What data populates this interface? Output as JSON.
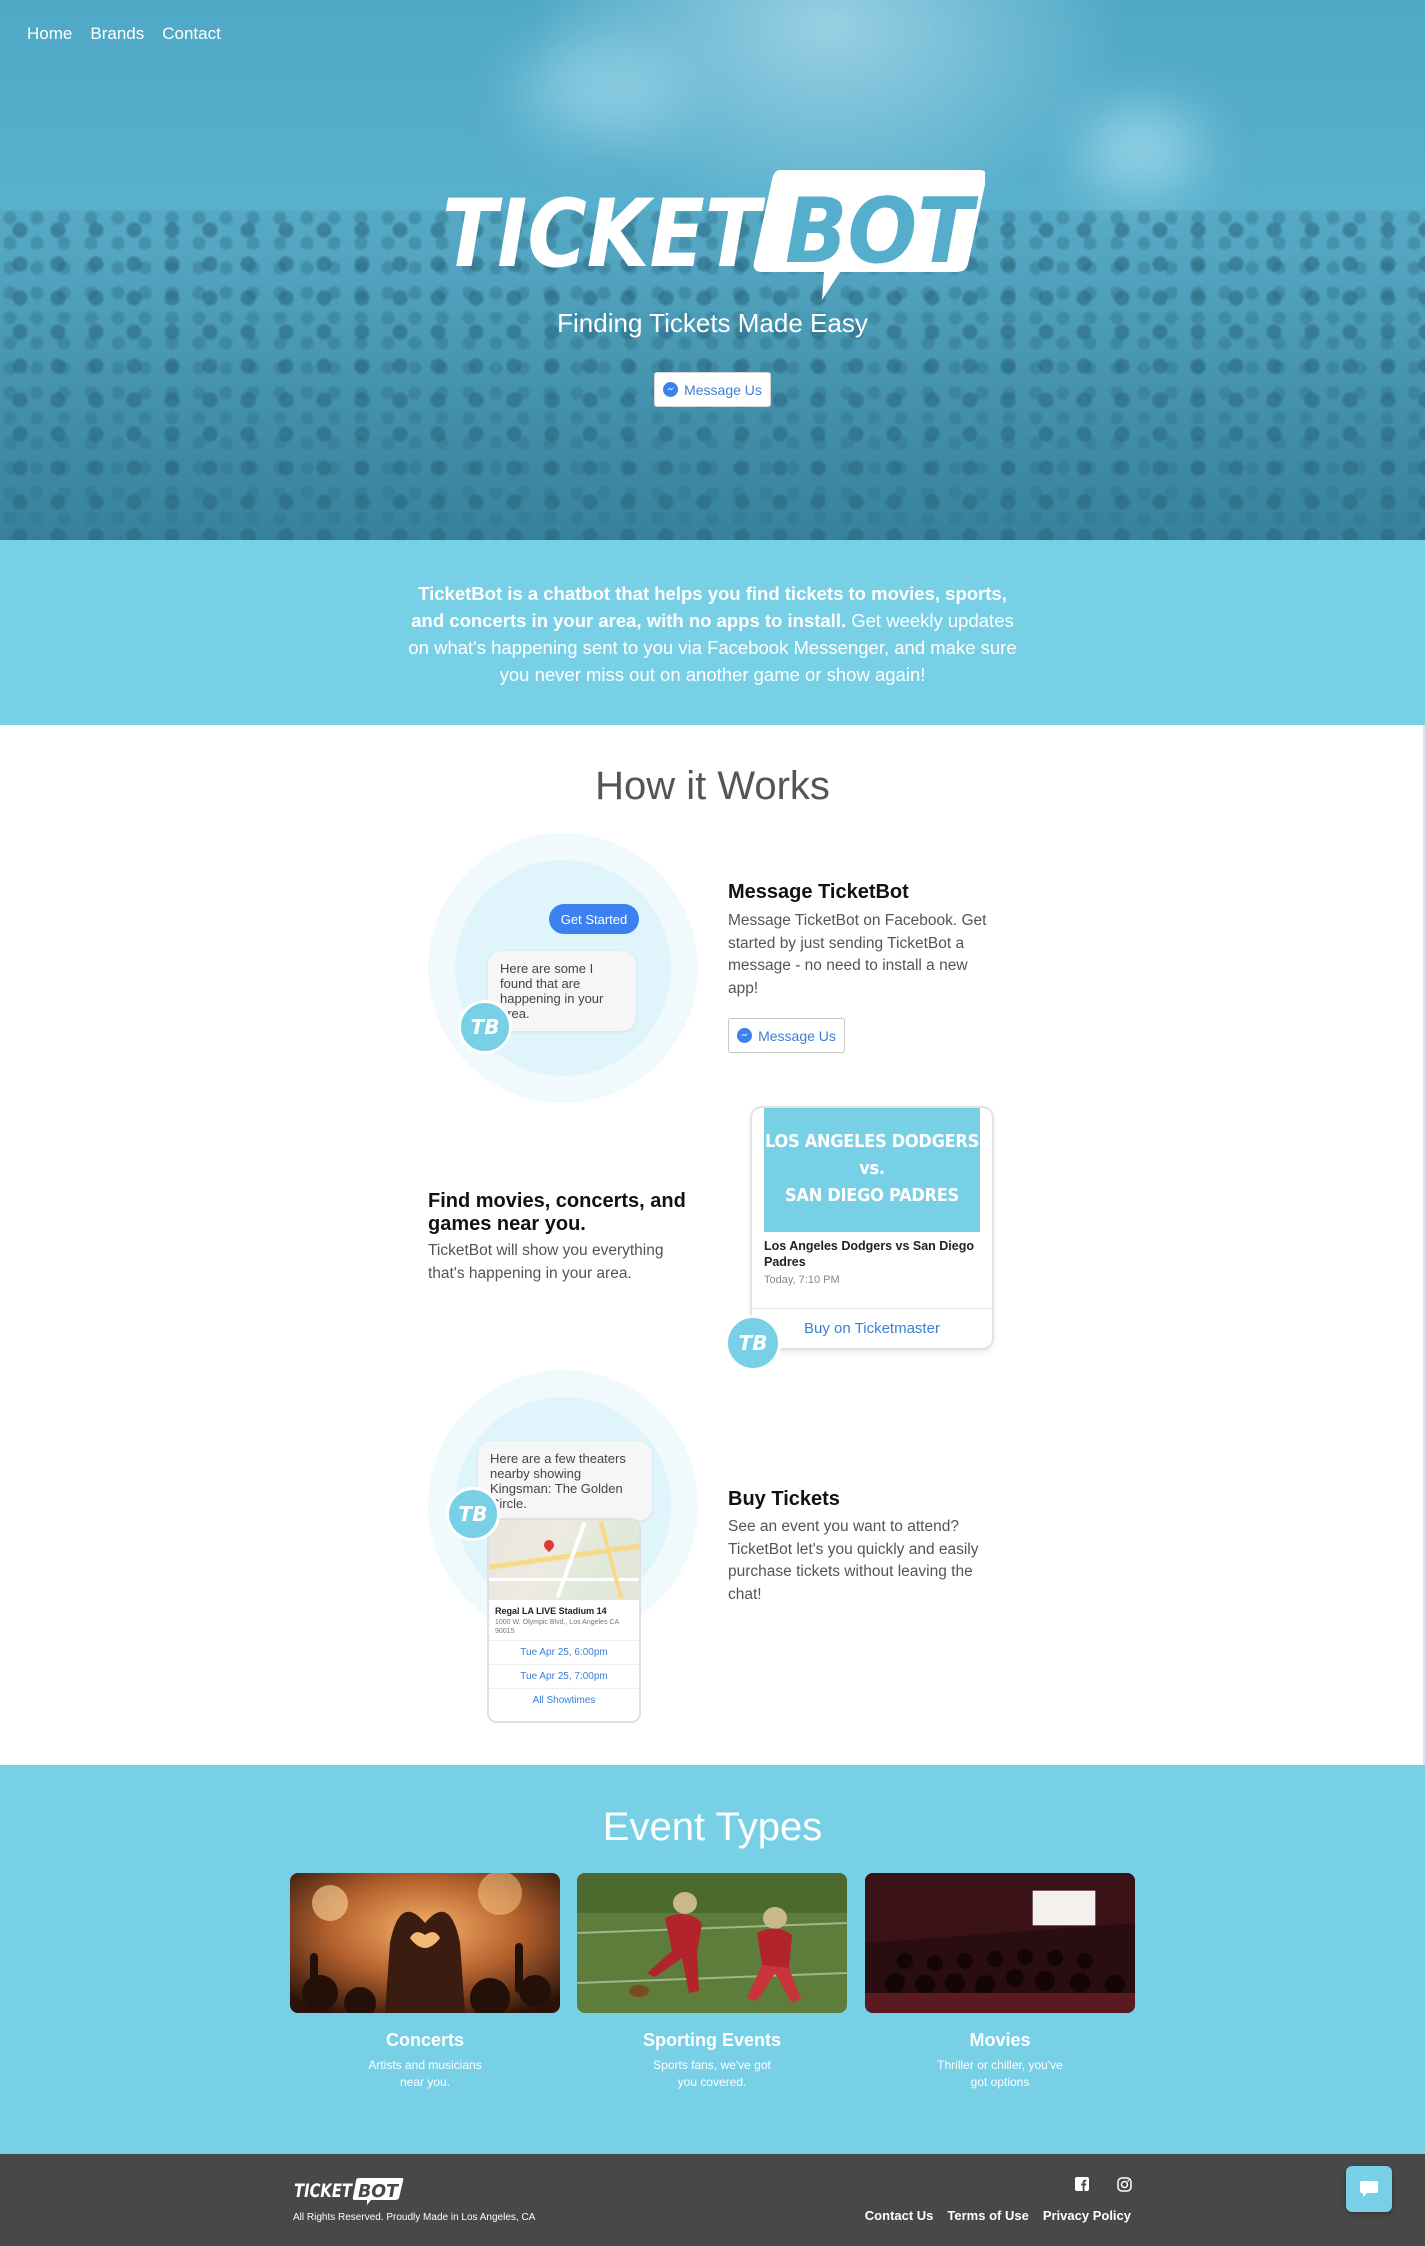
{
  "nav": {
    "items": [
      "Home",
      "Brands",
      "Contact"
    ]
  },
  "hero": {
    "logo_left": "TICKET",
    "logo_right": "BOT",
    "tagline": "Finding Tickets Made Easy",
    "cta_label": "Message Us"
  },
  "intro": {
    "bold": "TicketBot is a chatbot that helps you find tickets to movies, sports, and concerts in your area, with no apps to install.",
    "rest": " Get weekly updates on what's happening sent to you via Facebook Messenger, and make sure you never miss out on another game or show again!"
  },
  "how_it_works": {
    "title": "How it Works",
    "step1": {
      "title": "Message TicketBot",
      "text": "Message TicketBot on Facebook. Get started by just sending TicketBot a message - no need to install a new app!",
      "button": "Message Us",
      "pill": "Get Started",
      "bubble": "Here are some I found that are happening in your area.",
      "badge": "TB"
    },
    "step2": {
      "title": "Find movies, concerts, and games near you.",
      "text": "TicketBot will show you everything that's happening in your area.",
      "card_line1": "LOS ANGELES DODGERS",
      "card_line2": "vs.",
      "card_line3": "SAN DIEGO PADRES",
      "card_title": "Los Angeles Dodgers vs San Diego Padres",
      "card_time": "Today, 7:10 PM",
      "card_buy": "Buy on Ticketmaster",
      "badge": "TB"
    },
    "step3": {
      "title": "Buy Tickets",
      "text": "See an event you want to attend? TicketBot let's you quickly and easily purchase tickets without leaving the chat!",
      "bubble": "Here are a few theaters nearby showing Kingsman: The Golden Circle.",
      "theater_name": "Regal LA LIVE Stadium 14",
      "theater_addr": "1000 W. Olympic Blvd., Los Angeles CA 90015",
      "showtimes": [
        "Tue Apr 25, 6:00pm",
        "Tue Apr 25, 7:00pm",
        "All Showtimes"
      ],
      "badge": "TB"
    }
  },
  "events": {
    "title": "Event Types",
    "items": [
      {
        "name": "Concerts",
        "desc": "Artists and musicians near you."
      },
      {
        "name": "Sporting Events",
        "desc": "Sports fans, we've got you covered."
      },
      {
        "name": "Movies",
        "desc": "Thriller or chiller, you've got options"
      }
    ]
  },
  "footer": {
    "logo_left": "TICKET",
    "logo_right": "BOT",
    "copyright": "All Rights Reserved. Proudly Made in Los Angeles, CA",
    "links": [
      "Contact Us",
      "Terms of Use",
      "Privacy Policy"
    ],
    "social": [
      "facebook-icon",
      "instagram-icon"
    ]
  },
  "colors": {
    "brand": "#78d0e7",
    "hero": "#55aecb",
    "link": "#3a7fd6",
    "messenger": "#3b82f0",
    "footer": "#484848"
  }
}
